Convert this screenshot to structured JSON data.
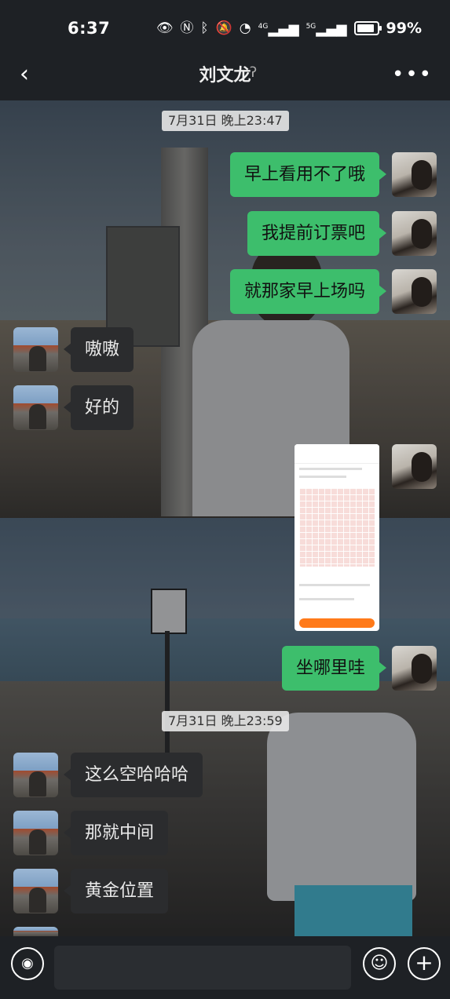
{
  "status_bar": {
    "time": "6:37",
    "icons": [
      "eye-icon",
      "nfc-icon",
      "bluetooth-icon",
      "mute-icon",
      "wifi-icon",
      "signal-4g-icon",
      "signal-5g-icon",
      "battery-icon"
    ],
    "net1": "4G",
    "net2": "5G",
    "battery": "99%"
  },
  "header": {
    "back": "‹",
    "title": "刘文龙",
    "more": "•••"
  },
  "messages": {
    "ts1": "7月31日 晚上23:47",
    "m1": "早上看用不了哦",
    "m2": "我提前订票吧",
    "m3": "就那家早上场吗",
    "m4": "嗷嗷",
    "m5": "好的",
    "m6": "坐哪里哇",
    "ts2": "7月31日 晚上23:59",
    "m7": "这么空哈哈哈",
    "m8": "那就中间",
    "m9": "黄金位置"
  },
  "input_bar": {
    "voice": "voice-icon",
    "emoji": "emoji-icon",
    "plus": "+"
  },
  "colors": {
    "bubble_me": "#3dbe6c",
    "bubble_other": "#2b2c2e",
    "bar_bg": "#1e2125"
  }
}
